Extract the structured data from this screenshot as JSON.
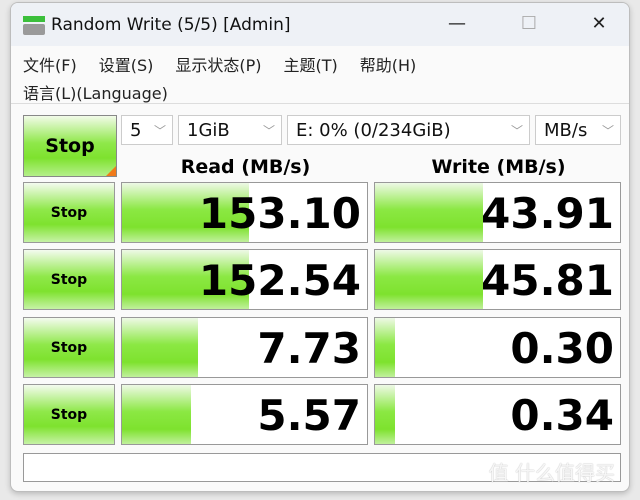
{
  "window": {
    "title": "Random Write (5/5) [Admin]",
    "minimize": "—",
    "maximize": "☐",
    "close": "✕"
  },
  "menu": {
    "file": "文件(F)",
    "settings": "设置(S)",
    "display": "显示状态(P)",
    "theme": "主题(T)",
    "help": "帮助(H)",
    "language": "语言(L)(Language)"
  },
  "controls": {
    "start_label": "Stop",
    "count": "5",
    "size": "1GiB",
    "drive": "E: 0% (0/234GiB)",
    "unit": "MB/s"
  },
  "headers": {
    "read": "Read (MB/s)",
    "write": "Write (MB/s)"
  },
  "rows": [
    {
      "button": "Stop",
      "read": "153.10",
      "write": "43.91",
      "read_fill_pct": 52,
      "write_fill_pct": 44
    },
    {
      "button": "Stop",
      "read": "152.54",
      "write": "45.81",
      "read_fill_pct": 52,
      "write_fill_pct": 44
    },
    {
      "button": "Stop",
      "read": "7.73",
      "write": "0.30",
      "read_fill_pct": 31,
      "write_fill_pct": 8
    },
    {
      "button": "Stop",
      "read": "5.57",
      "write": "0.34",
      "read_fill_pct": 28,
      "write_fill_pct": 8
    }
  ],
  "status": "",
  "watermark": "值 什么值得买",
  "colors": {
    "accent_green": "#7ee22e",
    "corner_orange": "#f07a1a"
  }
}
